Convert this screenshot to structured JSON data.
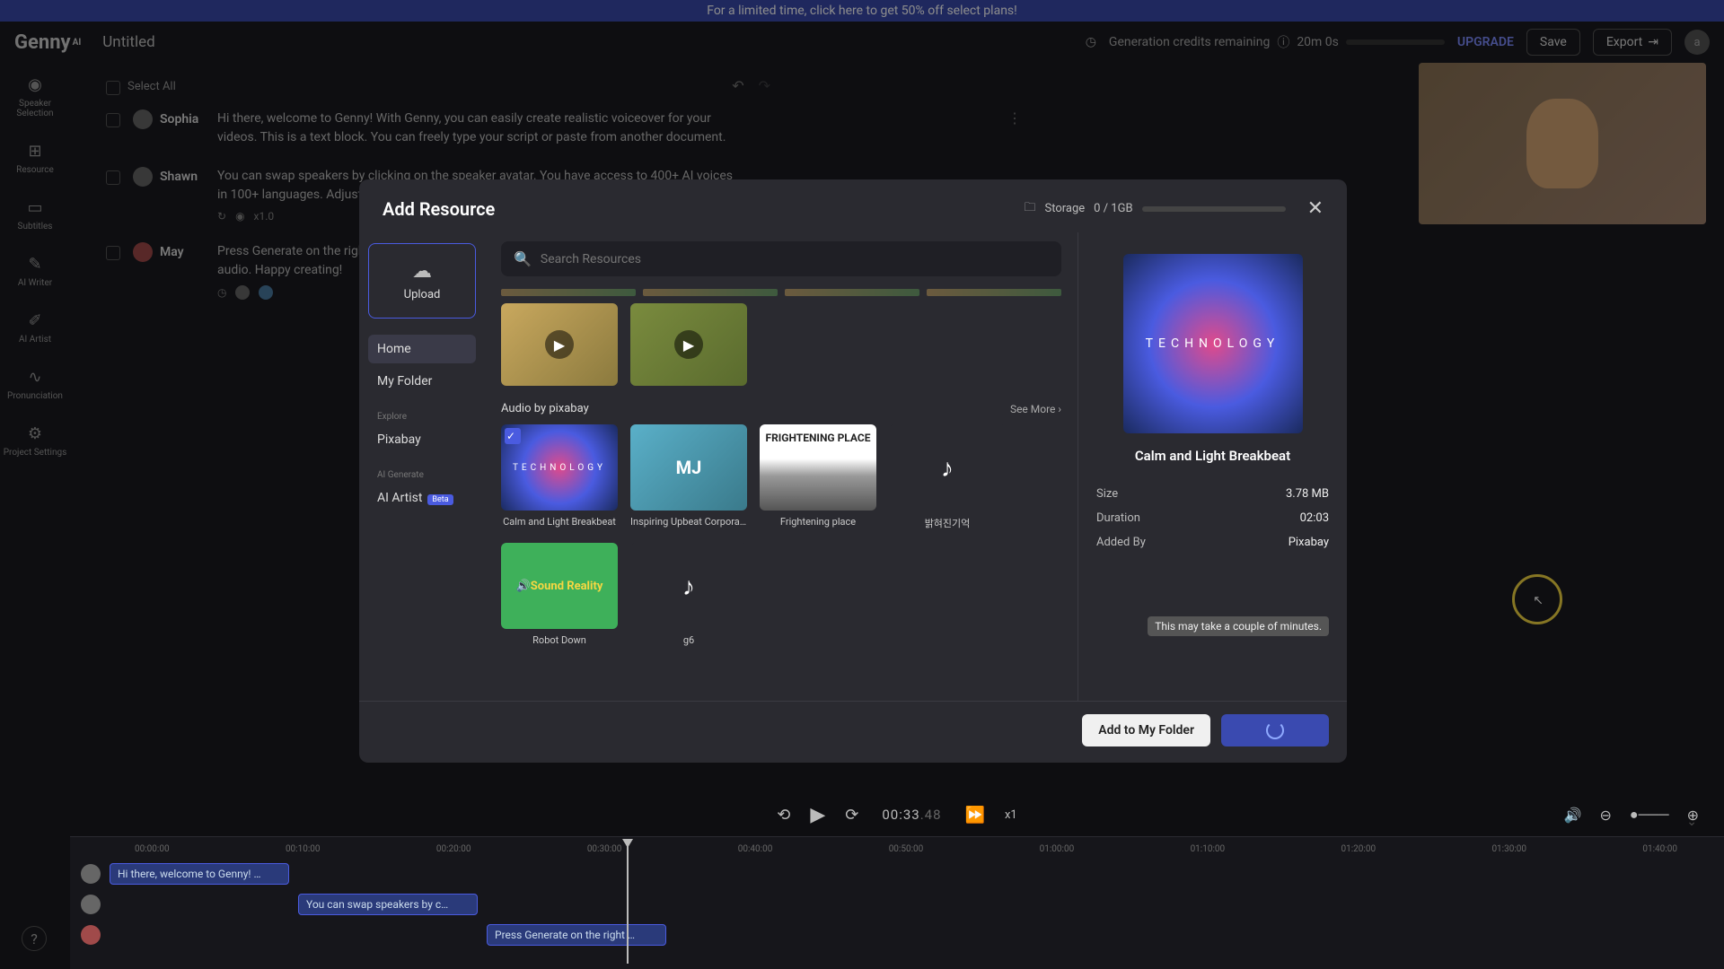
{
  "promo": {
    "text": "For a limited time, click here to get 50% off select plans!"
  },
  "app": {
    "logo": "Genny",
    "logo_sup": "AI",
    "project_title": "Untitled"
  },
  "header": {
    "credits_label": "Generation credits remaining",
    "credits_value": "20m 0s",
    "upgrade": "UPGRADE",
    "save": "Save",
    "export": "Export",
    "avatar_initial": "a"
  },
  "rail": {
    "items": [
      {
        "label": "Speaker Selection"
      },
      {
        "label": "Resource"
      },
      {
        "label": "Subtitles"
      },
      {
        "label": "AI Writer"
      },
      {
        "label": "AI Artist"
      },
      {
        "label": "Pronunciation"
      },
      {
        "label": "Project Settings"
      }
    ]
  },
  "script": {
    "select_all": "Select All",
    "blocks": [
      {
        "speaker": "Sophia",
        "text": "Hi there, welcome to Genny! With Genny, you can easily create realistic voiceover for your videos. This is a text block. You can freely type your script or paste from another document."
      },
      {
        "speaker": "Shawn",
        "text": "You can swap speakers by clicking on the speaker avatar. You have access to 400+ AI voices in 100+ languages. Adjust speed, emphasis, pause, and more to create videos that…"
      },
      {
        "speaker": "May",
        "text": "Press Generate on the right side of the block or Generate All in the top right to autogenerate audio. Happy creating!"
      }
    ],
    "speed_chip": "x1.0"
  },
  "modal": {
    "title": "Add Resource",
    "storage_label": "Storage",
    "storage_value": "0 / 1GB",
    "upload": "Upload",
    "nav": {
      "home": "Home",
      "my_folder": "My Folder",
      "explore_label": "Explore",
      "pixabay": "Pixabay",
      "ai_generate_label": "AI Generate",
      "ai_artist": "AI Artist",
      "beta": "Beta"
    },
    "search_placeholder": "Search Resources",
    "audio_section": "Audio by pixabay",
    "see_more": "See More",
    "audio_items": [
      {
        "title": "Calm and Light Breakbeat",
        "art_text": "TECHNOLOGY"
      },
      {
        "title": "Inspiring Upbeat Corporate…",
        "art_text": "MJ"
      },
      {
        "title": "Frightening place",
        "art_text": "FRIGHTENING PLACE"
      },
      {
        "title": "밝혀진기억",
        "art_text": "♪"
      },
      {
        "title": "Robot Down",
        "art_text": "🔊Sound Reality"
      },
      {
        "title": "g6",
        "art_text": "♪"
      }
    ],
    "detail": {
      "art_text": "TECHNOLOGY",
      "title": "Calm and Light Breakbeat",
      "size_label": "Size",
      "size_value": "3.78 MB",
      "duration_label": "Duration",
      "duration_value": "02:03",
      "added_by_label": "Added By",
      "added_by_value": "Pixabay"
    },
    "tooltip": "This may take a couple of minutes.",
    "add_to_folder": "Add to My Folder"
  },
  "transport": {
    "timecode": "00:33",
    "timecode_frac": ".48",
    "speed": "x1"
  },
  "timeline": {
    "ruler": [
      "00:00:00",
      "00:10:00",
      "00:20:00",
      "00:30:00",
      "00:40:00",
      "00:50:00",
      "01:00:00",
      "01:10:00",
      "01:20:00",
      "01:30:00",
      "01:40:00"
    ],
    "clips": [
      "Hi there, welcome to Genny! …",
      "You can swap speakers by c…",
      "Press Generate on the right …"
    ]
  }
}
